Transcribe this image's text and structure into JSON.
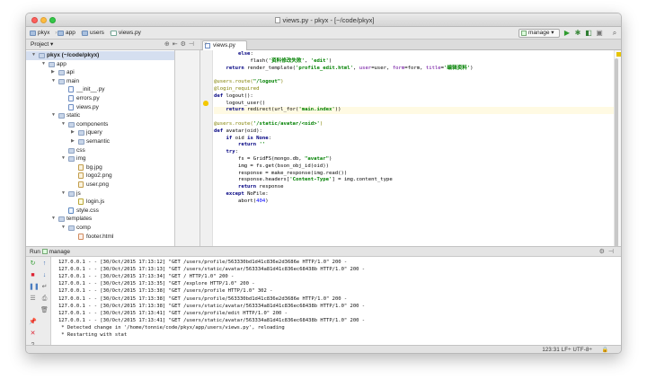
{
  "window": {
    "title": "views.py - pkyx - [~/code/pkyx]"
  },
  "breadcrumbs": [
    "pkyx",
    "app",
    "users",
    "views.py"
  ],
  "toolbar": {
    "run_config": "manage",
    "play_icon": "run-icon",
    "debug_icon": "debug-icon",
    "search_icon": "search-icon"
  },
  "project_panel": {
    "label": "Project",
    "dropdown": "▾"
  },
  "tree": [
    {
      "depth": 0,
      "name": "pkyx (~/code/pkyx)",
      "type": "folder",
      "open": true,
      "bold": true
    },
    {
      "depth": 1,
      "name": "app",
      "type": "folder",
      "open": true
    },
    {
      "depth": 2,
      "name": "api",
      "type": "folder",
      "open": false
    },
    {
      "depth": 2,
      "name": "main",
      "type": "folder",
      "open": true
    },
    {
      "depth": 3,
      "name": "__init__.py",
      "type": "pyf"
    },
    {
      "depth": 3,
      "name": "errors.py",
      "type": "pyf"
    },
    {
      "depth": 3,
      "name": "views.py",
      "type": "pyf"
    },
    {
      "depth": 2,
      "name": "static",
      "type": "folder",
      "open": true
    },
    {
      "depth": 3,
      "name": "components",
      "type": "folder",
      "open": true
    },
    {
      "depth": 4,
      "name": "jquery",
      "type": "folder",
      "open": false
    },
    {
      "depth": 4,
      "name": "semantic",
      "type": "folder",
      "open": false
    },
    {
      "depth": 3,
      "name": "css",
      "type": "folder",
      "open": null
    },
    {
      "depth": 3,
      "name": "img",
      "type": "folder",
      "open": true
    },
    {
      "depth": 4,
      "name": "bg.jpg",
      "type": "img"
    },
    {
      "depth": 4,
      "name": "logo2.png",
      "type": "img"
    },
    {
      "depth": 4,
      "name": "user.png",
      "type": "img"
    },
    {
      "depth": 3,
      "name": "js",
      "type": "folder",
      "open": true
    },
    {
      "depth": 4,
      "name": "login.js",
      "type": "js"
    },
    {
      "depth": 3,
      "name": "style.css",
      "type": "css"
    },
    {
      "depth": 2,
      "name": "templates",
      "type": "folder",
      "open": true
    },
    {
      "depth": 3,
      "name": "comp",
      "type": "folder",
      "open": true
    },
    {
      "depth": 4,
      "name": "footer.html",
      "type": "html"
    }
  ],
  "editor": {
    "tab": "views.py",
    "lines": [
      {
        "indent": "        ",
        "parts": [
          [
            "kw",
            "else"
          ],
          [
            "",
            ":"
          ]
        ]
      },
      {
        "indent": "            ",
        "parts": [
          [
            "",
            "flash("
          ],
          [
            "st",
            "'资料修改失败'"
          ],
          [
            "",
            ", "
          ],
          [
            "st",
            "'edit'"
          ],
          [
            "",
            ")"
          ]
        ]
      },
      {
        "indent": "    ",
        "parts": [
          [
            "kw",
            "return "
          ],
          [
            "",
            "render_template("
          ],
          [
            "st",
            "'profile_edit.html'"
          ],
          [
            "",
            ", "
          ],
          [
            "kv",
            "user"
          ],
          [
            "",
            "=user, "
          ],
          [
            "kv",
            "form"
          ],
          [
            "",
            "=form, "
          ],
          [
            "kv",
            "title"
          ],
          [
            "",
            "="
          ],
          [
            "st",
            "'编辑资料'"
          ],
          [
            "",
            ")"
          ]
        ]
      },
      {
        "indent": "",
        "parts": []
      },
      {
        "indent": "",
        "parts": [
          [
            "dc",
            "@users.route("
          ],
          [
            "st",
            "\"/logout\""
          ],
          [
            "dc",
            ")"
          ]
        ]
      },
      {
        "indent": "",
        "parts": [
          [
            "dc",
            "@login_required"
          ]
        ]
      },
      {
        "indent": "",
        "parts": [
          [
            "kw",
            "def "
          ],
          [
            "",
            "logout():"
          ]
        ]
      },
      {
        "indent": "    ",
        "parts": [
          [
            "",
            "logout_user()"
          ]
        ],
        "bulb": true
      },
      {
        "indent": "    ",
        "parts": [
          [
            "kw",
            "return "
          ],
          [
            "",
            "redirect(url_for("
          ],
          [
            "st",
            "'main.index'"
          ],
          [
            "",
            "))"
          ]
        ],
        "highlight": true
      },
      {
        "indent": "",
        "parts": []
      },
      {
        "indent": "",
        "parts": [
          [
            "dc",
            "@users.route("
          ],
          [
            "st",
            "'/static/avatar/<oid>'"
          ],
          [
            "dc",
            ")"
          ]
        ]
      },
      {
        "indent": "",
        "parts": [
          [
            "kw",
            "def "
          ],
          [
            "",
            "avatar(oid):"
          ]
        ]
      },
      {
        "indent": "    ",
        "parts": [
          [
            "kw",
            "if "
          ],
          [
            "",
            "oid "
          ],
          [
            "kw",
            "is None"
          ],
          [
            "",
            ":"
          ]
        ]
      },
      {
        "indent": "        ",
        "parts": [
          [
            "kw",
            "return "
          ],
          [
            "st",
            "''"
          ]
        ]
      },
      {
        "indent": "    ",
        "parts": [
          [
            "kw",
            "try"
          ],
          [
            "",
            ":"
          ]
        ]
      },
      {
        "indent": "        ",
        "parts": [
          [
            "",
            "fs = GridFS(mongo.db, "
          ],
          [
            "st",
            "\"avatar\""
          ],
          [
            "",
            ")"
          ]
        ]
      },
      {
        "indent": "        ",
        "parts": [
          [
            "",
            "img = fs.get(bson_obj_id(oid))"
          ]
        ]
      },
      {
        "indent": "        ",
        "parts": [
          [
            "",
            "response = make_response(img.read())"
          ]
        ]
      },
      {
        "indent": "        ",
        "parts": [
          [
            "",
            "response.headers["
          ],
          [
            "st",
            "'Content-Type'"
          ],
          [
            "",
            "] = img.content_type"
          ]
        ]
      },
      {
        "indent": "        ",
        "parts": [
          [
            "kw",
            "return "
          ],
          [
            "",
            "response"
          ]
        ]
      },
      {
        "indent": "    ",
        "parts": [
          [
            "kw",
            "except "
          ],
          [
            "",
            "NoFile:"
          ]
        ]
      },
      {
        "indent": "        ",
        "parts": [
          [
            "",
            "abort("
          ],
          [
            "nm",
            "404"
          ],
          [
            "",
            ")"
          ]
        ]
      }
    ]
  },
  "run_panel": {
    "label": "Run",
    "config": "manage"
  },
  "console_lines": [
    "127.0.0.1 - - [30/Oct/2015 17:13:12] \"GET /users/profile/563330bd1d41c836e2d3686e HTTP/1.0\" 200 -",
    "127.0.0.1 - - [30/Oct/2015 17:13:13] \"GET /users/static/avatar/563334a81d41c836ec68438b HTTP/1.0\" 200 -",
    "127.0.0.1 - - [30/Oct/2015 17:13:34] \"GET / HTTP/1.0\" 200 -",
    "127.0.0.1 - - [30/Oct/2015 17:13:35] \"GET /explore HTTP/1.0\" 200 -",
    "127.0.0.1 - - [30/Oct/2015 17:13:38] \"GET /users/profile HTTP/1.0\" 302 -",
    "127.0.0.1 - - [30/Oct/2015 17:13:38] \"GET /users/profile/563330bd1d41c836e2d3686e HTTP/1.0\" 200 -",
    "127.0.0.1 - - [30/Oct/2015 17:13:38] \"GET /users/static/avatar/563334a81d41c836ec68438b HTTP/1.0\" 200 -",
    "127.0.0.1 - - [30/Oct/2015 17:13:41] \"GET /users/profile/edit HTTP/1.0\" 200 -",
    "127.0.0.1 - - [30/Oct/2015 17:13:41] \"GET /users/static/avatar/563334a81d41c836ec68438b HTTP/1.0\" 200 -",
    " * Detected change in '/home/tonnie/code/pkyx/app/users/views.py', reloading",
    " * Restarting with stat"
  ],
  "status": {
    "text": "123:31  LF÷  UTF-8÷",
    "lock": "🔒"
  }
}
